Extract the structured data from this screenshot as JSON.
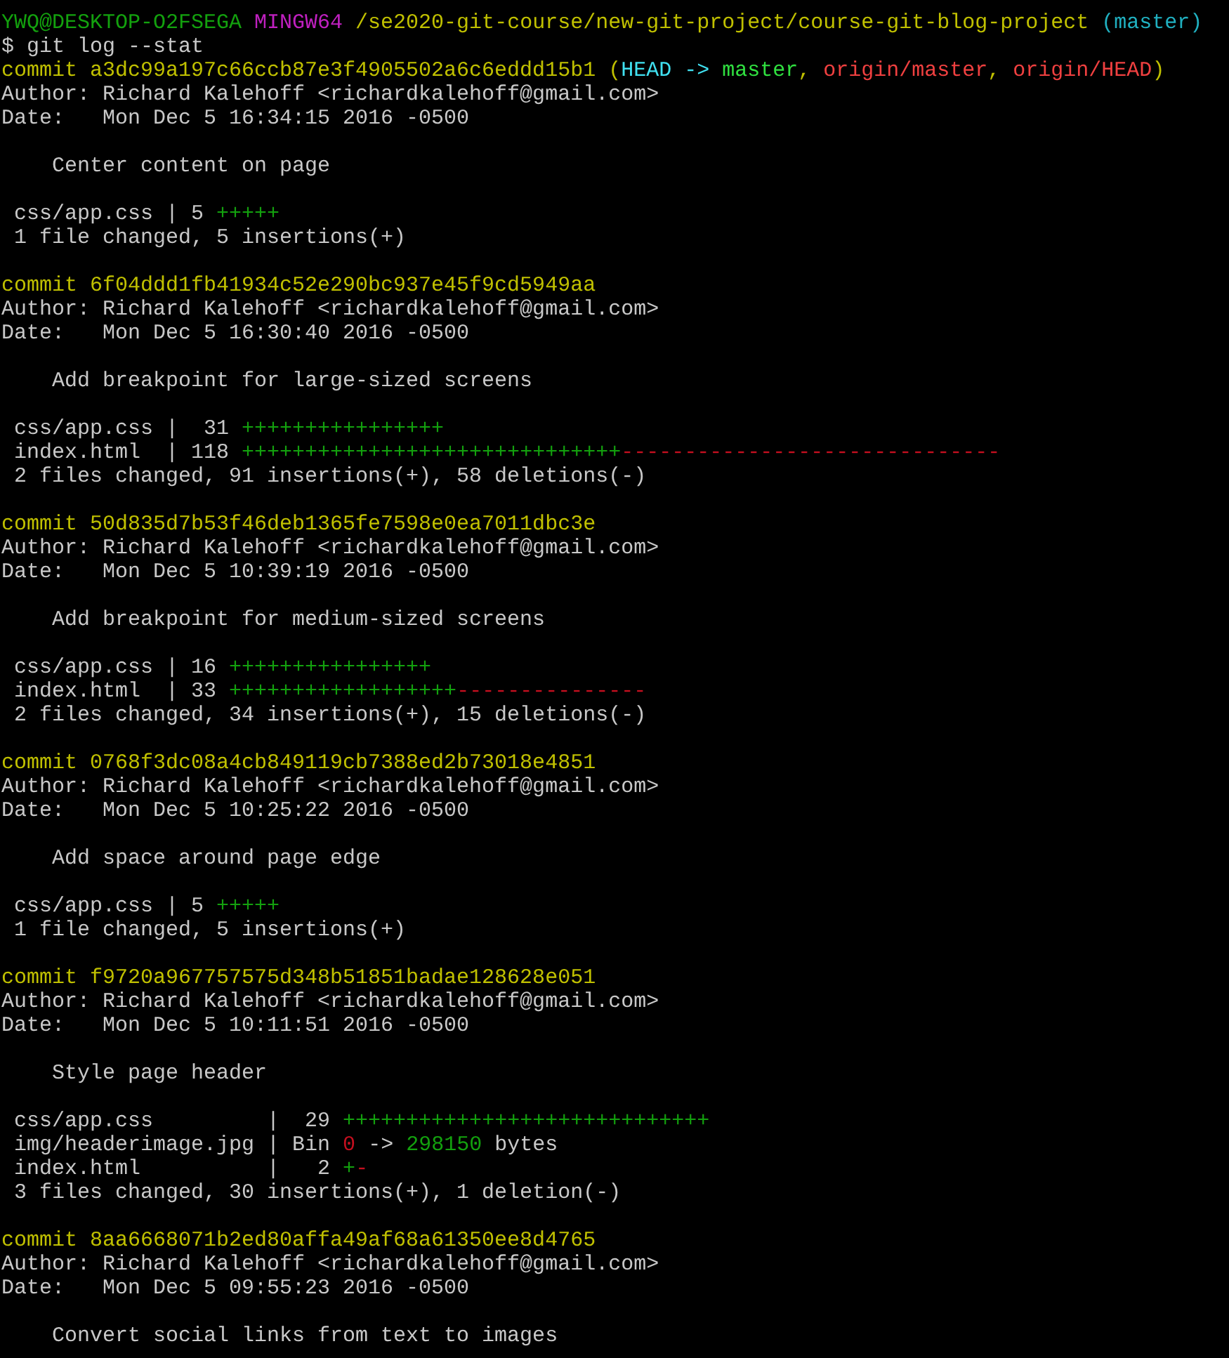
{
  "terminal": {
    "lines": [
      {
        "kind": "text",
        "segments": [
          {
            "text": "YWQ@DESKTOP-O2FSEGA ",
            "color": "#13a10e"
          },
          {
            "text": "MINGW64 ",
            "color": "#c020c0"
          },
          {
            "text": "/se2020-git-course/new-git-project/course-git-blog-project ",
            "color": "#c0c000"
          },
          {
            "text": "(master)",
            "color": "#20b0c0"
          }
        ]
      },
      {
        "kind": "text",
        "segments": [
          {
            "text": "$ git log --stat"
          }
        ]
      },
      {
        "kind": "text",
        "segments": [
          {
            "text": "commit a3dc99a197c66ccb87e3f4905502a6c6eddd15b1 (",
            "color": "#c0c000"
          },
          {
            "text": "HEAD -> ",
            "color": "#40e0f0"
          },
          {
            "text": "master",
            "color": "#30e040"
          },
          {
            "text": ", ",
            "color": "#c0c000"
          },
          {
            "text": "origin/master",
            "color": "#f04040"
          },
          {
            "text": ", ",
            "color": "#c0c000"
          },
          {
            "text": "origin/HEAD",
            "color": "#f04040"
          },
          {
            "text": ")",
            "color": "#c0c000"
          }
        ]
      },
      {
        "kind": "text",
        "segments": [
          {
            "text": "Author: Richard Kalehoff <richardkalehoff@gmail.com>"
          }
        ]
      },
      {
        "kind": "text",
        "segments": [
          {
            "text": "Date:   Mon Dec 5 16:34:15 2016 -0500"
          }
        ]
      },
      {
        "kind": "blank"
      },
      {
        "kind": "text",
        "segments": [
          {
            "text": "    Center content on page"
          }
        ]
      },
      {
        "kind": "blank"
      },
      {
        "kind": "text",
        "segments": [
          {
            "text": " css/app.css | 5 "
          },
          {
            "text": "+++++",
            "color": "#13a10e"
          }
        ]
      },
      {
        "kind": "text",
        "segments": [
          {
            "text": " 1 file changed, 5 insertions(+)"
          }
        ]
      },
      {
        "kind": "blank"
      },
      {
        "kind": "text",
        "segments": [
          {
            "text": "commit 6f04ddd1fb41934c52e290bc937e45f9cd5949aa",
            "color": "#c0c000"
          }
        ]
      },
      {
        "kind": "text",
        "segments": [
          {
            "text": "Author: Richard Kalehoff <richardkalehoff@gmail.com>"
          }
        ]
      },
      {
        "kind": "text",
        "segments": [
          {
            "text": "Date:   Mon Dec 5 16:30:40 2016 -0500"
          }
        ]
      },
      {
        "kind": "blank"
      },
      {
        "kind": "text",
        "segments": [
          {
            "text": "    Add breakpoint for large-sized screens"
          }
        ]
      },
      {
        "kind": "blank"
      },
      {
        "kind": "text",
        "segments": [
          {
            "text": " css/app.css |  31 "
          },
          {
            "text": "++++++++++++++++",
            "color": "#13a10e"
          }
        ]
      },
      {
        "kind": "text",
        "segments": [
          {
            "text": " index.html  | 118 "
          },
          {
            "text": "++++++++++++++++++++++++++++++",
            "color": "#13a10e"
          },
          {
            "text": "------------------------------",
            "color": "#c50f1f"
          }
        ]
      },
      {
        "kind": "text",
        "segments": [
          {
            "text": " 2 files changed, 91 insertions(+), 58 deletions(-)"
          }
        ]
      },
      {
        "kind": "blank"
      },
      {
        "kind": "text",
        "segments": [
          {
            "text": "commit 50d835d7b53f46deb1365fe7598e0ea7011dbc3e",
            "color": "#c0c000"
          }
        ]
      },
      {
        "kind": "text",
        "segments": [
          {
            "text": "Author: Richard Kalehoff <richardkalehoff@gmail.com>"
          }
        ]
      },
      {
        "kind": "text",
        "segments": [
          {
            "text": "Date:   Mon Dec 5 10:39:19 2016 -0500"
          }
        ]
      },
      {
        "kind": "blank"
      },
      {
        "kind": "text",
        "segments": [
          {
            "text": "    Add breakpoint for medium-sized screens"
          }
        ]
      },
      {
        "kind": "blank"
      },
      {
        "kind": "text",
        "segments": [
          {
            "text": " css/app.css | 16 "
          },
          {
            "text": "++++++++++++++++",
            "color": "#13a10e"
          }
        ]
      },
      {
        "kind": "text",
        "segments": [
          {
            "text": " index.html  | 33 "
          },
          {
            "text": "++++++++++++++++++",
            "color": "#13a10e"
          },
          {
            "text": "---------------",
            "color": "#c50f1f"
          }
        ]
      },
      {
        "kind": "text",
        "segments": [
          {
            "text": " 2 files changed, 34 insertions(+), 15 deletions(-)"
          }
        ]
      },
      {
        "kind": "blank"
      },
      {
        "kind": "text",
        "segments": [
          {
            "text": "commit 0768f3dc08a4cb849119cb7388ed2b73018e4851",
            "color": "#c0c000"
          }
        ]
      },
      {
        "kind": "text",
        "segments": [
          {
            "text": "Author: Richard Kalehoff <richardkalehoff@gmail.com>"
          }
        ]
      },
      {
        "kind": "text",
        "segments": [
          {
            "text": "Date:   Mon Dec 5 10:25:22 2016 -0500"
          }
        ]
      },
      {
        "kind": "blank"
      },
      {
        "kind": "text",
        "segments": [
          {
            "text": "    Add space around page edge"
          }
        ]
      },
      {
        "kind": "blank"
      },
      {
        "kind": "text",
        "segments": [
          {
            "text": " css/app.css | 5 "
          },
          {
            "text": "+++++",
            "color": "#13a10e"
          }
        ]
      },
      {
        "kind": "text",
        "segments": [
          {
            "text": " 1 file changed, 5 insertions(+)"
          }
        ]
      },
      {
        "kind": "blank"
      },
      {
        "kind": "text",
        "segments": [
          {
            "text": "commit f9720a967757575d348b51851badae128628e051",
            "color": "#c0c000"
          }
        ]
      },
      {
        "kind": "text",
        "segments": [
          {
            "text": "Author: Richard Kalehoff <richardkalehoff@gmail.com>"
          }
        ]
      },
      {
        "kind": "text",
        "segments": [
          {
            "text": "Date:   Mon Dec 5 10:11:51 2016 -0500"
          }
        ]
      },
      {
        "kind": "blank"
      },
      {
        "kind": "text",
        "segments": [
          {
            "text": "    Style page header"
          }
        ]
      },
      {
        "kind": "blank"
      },
      {
        "kind": "text",
        "segments": [
          {
            "text": " css/app.css         |  29 "
          },
          {
            "text": "+++++++++++++++++++++++++++++",
            "color": "#13a10e"
          }
        ]
      },
      {
        "kind": "text",
        "segments": [
          {
            "text": " img/headerimage.jpg | Bin "
          },
          {
            "text": "0",
            "color": "#c50f1f"
          },
          {
            "text": " -> "
          },
          {
            "text": "298150",
            "color": "#13a10e"
          },
          {
            "text": " bytes"
          }
        ]
      },
      {
        "kind": "text",
        "segments": [
          {
            "text": " index.html          |   2 "
          },
          {
            "text": "+",
            "color": "#13a10e"
          },
          {
            "text": "-",
            "color": "#c50f1f"
          }
        ]
      },
      {
        "kind": "text",
        "segments": [
          {
            "text": " 3 files changed, 30 insertions(+), 1 deletion(-)"
          }
        ]
      },
      {
        "kind": "blank"
      },
      {
        "kind": "text",
        "segments": [
          {
            "text": "commit 8aa6668071b2ed80affa49af68a61350ee8d4765",
            "color": "#c0c000"
          }
        ]
      },
      {
        "kind": "text",
        "segments": [
          {
            "text": "Author: Richard Kalehoff <richardkalehoff@gmail.com>"
          }
        ]
      },
      {
        "kind": "text",
        "segments": [
          {
            "text": "Date:   Mon Dec 5 09:55:23 2016 -0500"
          }
        ]
      },
      {
        "kind": "blank"
      },
      {
        "kind": "text",
        "segments": [
          {
            "text": "    Convert social links from text to images"
          }
        ]
      }
    ]
  }
}
